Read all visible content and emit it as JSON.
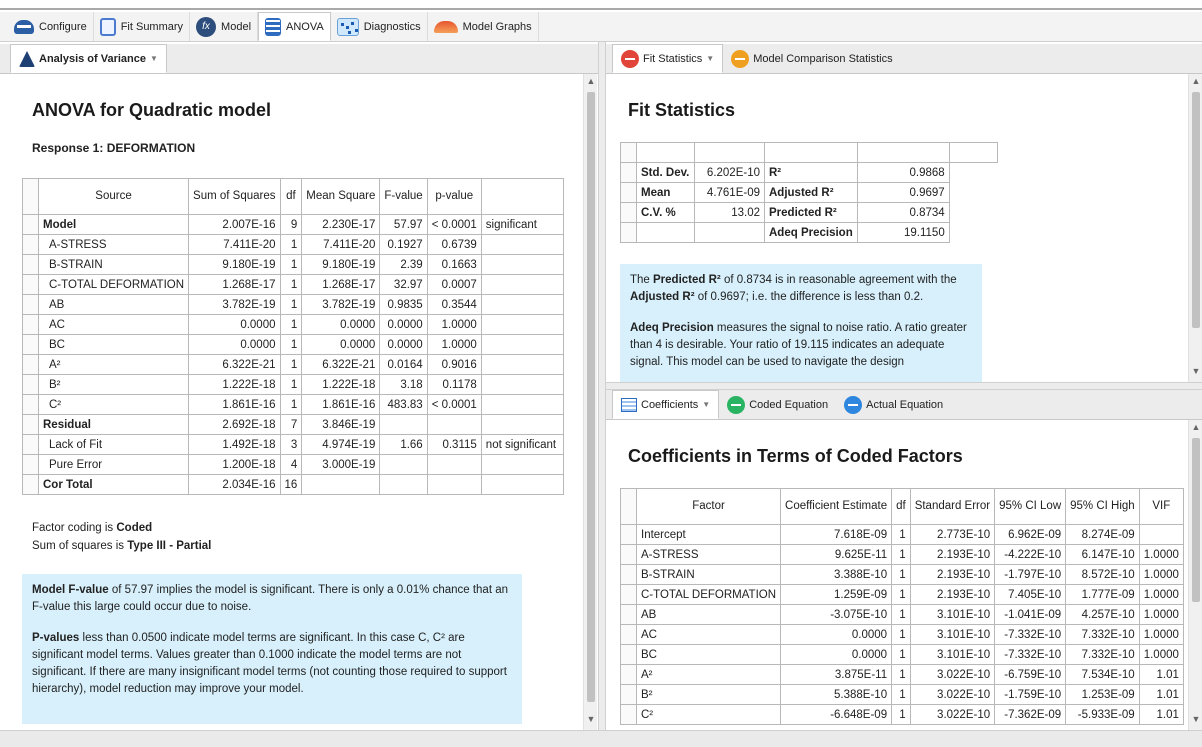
{
  "toolbar": {
    "tabs": [
      {
        "label": "Configure",
        "icon": "configure-icon"
      },
      {
        "label": "Fit Summary",
        "icon": "fit-summary-icon"
      },
      {
        "label": "Model",
        "icon": "model-icon"
      },
      {
        "label": "ANOVA",
        "icon": "anova-icon"
      },
      {
        "label": "Diagnostics",
        "icon": "diagnostics-icon"
      },
      {
        "label": "Model Graphs",
        "icon": "model-graphs-icon"
      }
    ]
  },
  "left_pane": {
    "tab_label": "Analysis of Variance",
    "title": "ANOVA for Quadratic model",
    "response": "Response 1: DEFORMATION",
    "headers": [
      "Source",
      "Sum of Squares",
      "df",
      "Mean Square",
      "F-value",
      "p-value",
      ""
    ],
    "rows": [
      [
        "Model",
        "2.007E-16",
        "9",
        "2.230E-17",
        "57.97",
        "< 0.0001",
        "significant"
      ],
      [
        "A-STRESS",
        "7.411E-20",
        "1",
        "7.411E-20",
        "0.1927",
        "0.6739",
        ""
      ],
      [
        "B-STRAIN",
        "9.180E-19",
        "1",
        "9.180E-19",
        "2.39",
        "0.1663",
        ""
      ],
      [
        "C-TOTAL DEFORMATION",
        "1.268E-17",
        "1",
        "1.268E-17",
        "32.97",
        "0.0007",
        ""
      ],
      [
        "AB",
        "3.782E-19",
        "1",
        "3.782E-19",
        "0.9835",
        "0.3544",
        ""
      ],
      [
        "AC",
        "0.0000",
        "1",
        "0.0000",
        "0.0000",
        "1.0000",
        ""
      ],
      [
        "BC",
        "0.0000",
        "1",
        "0.0000",
        "0.0000",
        "1.0000",
        ""
      ],
      [
        "A²",
        "6.322E-21",
        "1",
        "6.322E-21",
        "0.0164",
        "0.9016",
        ""
      ],
      [
        "B²",
        "1.222E-18",
        "1",
        "1.222E-18",
        "3.18",
        "0.1178",
        ""
      ],
      [
        "C²",
        "1.861E-16",
        "1",
        "1.861E-16",
        "483.83",
        "< 0.0001",
        ""
      ],
      [
        "Residual",
        "2.692E-18",
        "7",
        "3.846E-19",
        "",
        "",
        ""
      ],
      [
        "Lack of Fit",
        "1.492E-18",
        "3",
        "4.974E-19",
        "1.66",
        "0.3115",
        "not significant"
      ],
      [
        "Pure Error",
        "1.200E-18",
        "4",
        "3.000E-19",
        "",
        "",
        ""
      ],
      [
        "Cor Total",
        "2.034E-16",
        "16",
        "",
        "",
        "",
        ""
      ]
    ],
    "coding_prefix": "Factor coding is ",
    "coding_value": "Coded",
    "ss_prefix": "Sum of squares is ",
    "ss_value": "Type III - Partial",
    "info_p1_bold": "Model F-value",
    "info_p1_rest": " of 57.97 implies the model is significant. There is only a 0.01% chance that an F-value this large could occur due to noise.",
    "info_p2_bold": "P-values",
    "info_p2_rest": " less than 0.0500 indicate model terms are significant. In this case C, C² are significant model terms. Values greater than 0.1000 indicate the model terms are not significant. If there are many insignificant model terms (not counting those required to support hierarchy), model reduction may improve your model."
  },
  "fit_pane": {
    "tabs": [
      "Fit Statistics",
      "Model Comparison Statistics"
    ],
    "title": "Fit Statistics",
    "rows": [
      [
        "Std. Dev.",
        "6.202E-10",
        "R²",
        "0.9868"
      ],
      [
        "Mean",
        "4.761E-09",
        "Adjusted R²",
        "0.9697"
      ],
      [
        "C.V. %",
        "13.02",
        "Predicted R²",
        "0.8734"
      ],
      [
        "",
        "",
        "Adeq Precision",
        "19.1150"
      ]
    ],
    "info_a_bold1": "Predicted R²",
    "info_a_mid": " of 0.8734 is in reasonable agreement with the ",
    "info_a_bold2": "Adjusted R²",
    "info_a_end": " of 0.9697; i.e. the difference is less than 0.2.",
    "info_b_bold": "Adeq Precision",
    "info_b_rest": " measures the signal to noise ratio. A ratio greater than 4 is desirable. Your ratio of 19.115 indicates an adequate signal. This model can be used to navigate the design"
  },
  "coef_pane": {
    "tabs": [
      "Coefficients",
      "Coded Equation",
      "Actual Equation"
    ],
    "title": "Coefficients in Terms of Coded Factors",
    "headers": [
      "Factor",
      "Coefficient Estimate",
      "df",
      "Standard Error",
      "95% CI Low",
      "95% CI High",
      "VIF"
    ],
    "rows": [
      [
        "Intercept",
        "7.618E-09",
        "1",
        "2.773E-10",
        "6.962E-09",
        "8.274E-09",
        ""
      ],
      [
        "A-STRESS",
        "9.625E-11",
        "1",
        "2.193E-10",
        "-4.222E-10",
        "6.147E-10",
        "1.0000"
      ],
      [
        "B-STRAIN",
        "3.388E-10",
        "1",
        "2.193E-10",
        "-1.797E-10",
        "8.572E-10",
        "1.0000"
      ],
      [
        "C-TOTAL DEFORMATION",
        "1.259E-09",
        "1",
        "2.193E-10",
        "7.405E-10",
        "1.777E-09",
        "1.0000"
      ],
      [
        "AB",
        "-3.075E-10",
        "1",
        "3.101E-10",
        "-1.041E-09",
        "4.257E-10",
        "1.0000"
      ],
      [
        "AC",
        "0.0000",
        "1",
        "3.101E-10",
        "-7.332E-10",
        "7.332E-10",
        "1.0000"
      ],
      [
        "BC",
        "0.0000",
        "1",
        "3.101E-10",
        "-7.332E-10",
        "7.332E-10",
        "1.0000"
      ],
      [
        "A²",
        "3.875E-11",
        "1",
        "3.022E-10",
        "-6.759E-10",
        "7.534E-10",
        "1.01"
      ],
      [
        "B²",
        "5.388E-10",
        "1",
        "3.022E-10",
        "-1.759E-10",
        "1.253E-09",
        "1.01"
      ],
      [
        "C²",
        "-6.648E-09",
        "1",
        "3.022E-10",
        "-7.362E-09",
        "-5.933E-09",
        "1.01"
      ]
    ]
  }
}
